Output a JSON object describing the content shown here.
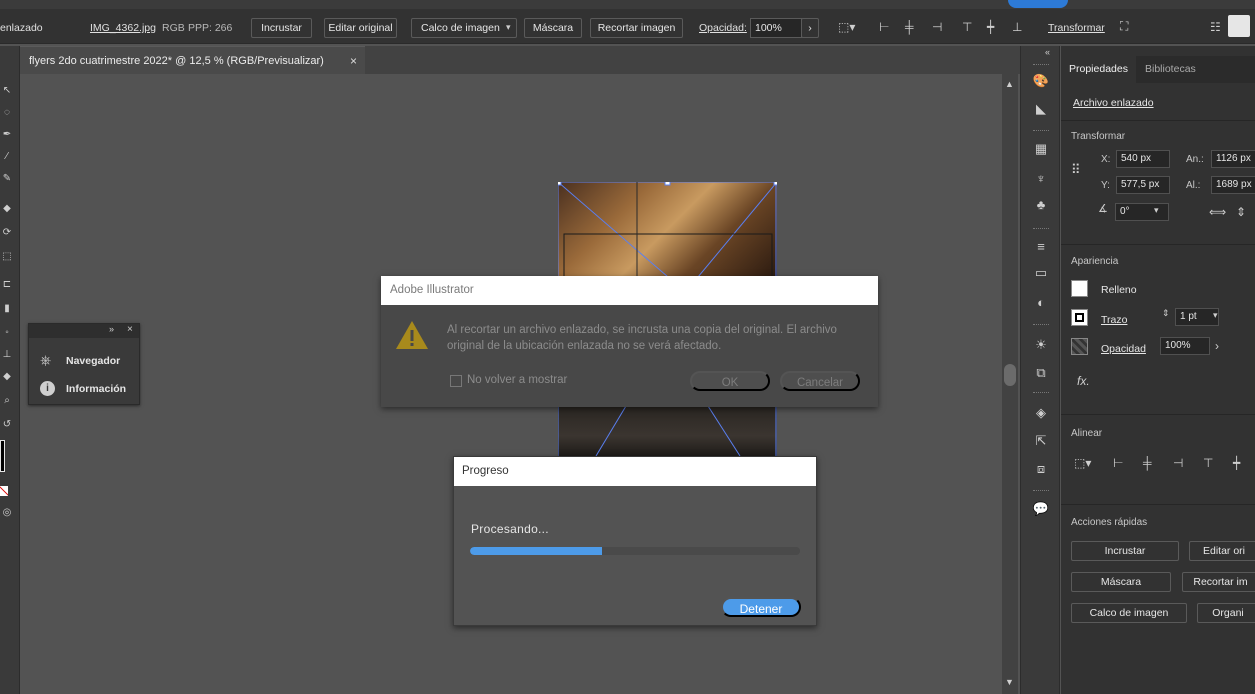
{
  "control_bar": {
    "object_type": "enlazado",
    "filename": "IMG_4362.jpg",
    "color_mode": "RGB",
    "ppi": "PPP: 266",
    "embed_label": "Incrustar",
    "edit_original_label": "Editar original",
    "image_trace_label": "Calco de imagen",
    "mask_label": "Máscara",
    "crop_label": "Recortar imagen",
    "opacity_label": "Opacidad:",
    "opacity_value": "100%",
    "transform_label": "Transformar"
  },
  "document_tab": {
    "title": "flyers 2do cuatrimestre 2022* @ 12,5 % (RGB/Previsualizar)",
    "close": "×"
  },
  "float_panel": {
    "items": [
      {
        "label": "Navegador",
        "icon": "navigator-wheel-icon"
      },
      {
        "label": "Información",
        "icon": "info-icon"
      }
    ]
  },
  "properties_panel": {
    "tabs": [
      "Propiedades",
      "Bibliotecas"
    ],
    "object_label": "Archivo enlazado",
    "transform": {
      "title": "Transformar",
      "x_label": "X:",
      "x_value": "540 px",
      "y_label": "Y:",
      "y_value": "577,5 px",
      "w_label": "An.:",
      "w_value": "1126 px",
      "h_label": "Al.:",
      "h_value": "1689 px",
      "angle_value": "0°"
    },
    "appearance": {
      "title": "Apariencia",
      "fill_label": "Relleno",
      "stroke_label": "Trazo",
      "stroke_value": "1 pt",
      "opacity_label": "Opacidad",
      "opacity_value": "100%",
      "fx_label": "fx."
    },
    "align": {
      "title": "Alinear"
    },
    "quick_actions": {
      "title": "Acciones rápidas",
      "embed": "Incrustar",
      "edit_original": "Editar ori",
      "mask": "Máscara",
      "crop": "Recortar im",
      "image_trace": "Calco de imagen",
      "organize": "Organi"
    }
  },
  "alert_dialog": {
    "title": "Adobe Illustrator",
    "message": "Al recortar un archivo enlazado, se incrusta una copia del original. El archivo original de la ubicación enlazada no se verá afectado.",
    "checkbox_label": "No volver a mostrar",
    "ok_label": "OK",
    "cancel_label": "Cancelar"
  },
  "progress_dialog": {
    "title": "Progreso",
    "status": "Procesando...",
    "progress": 0.4,
    "stop_label": "Detener",
    "accent": "#4d9be9"
  }
}
